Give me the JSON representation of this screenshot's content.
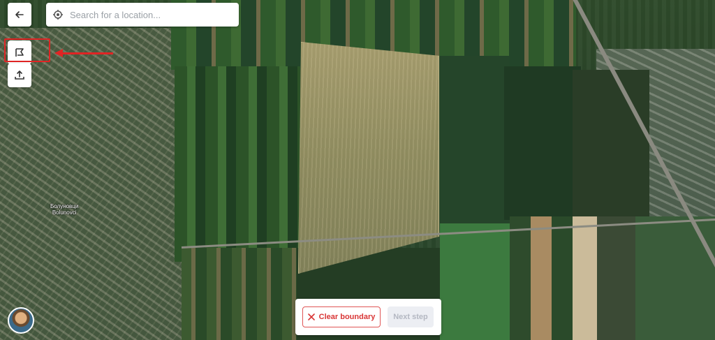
{
  "map": {
    "place_label_line1": "Болуновци",
    "place_label_line2": "Bolunovci"
  },
  "search": {
    "placeholder": "Search for a location..."
  },
  "toolbar": {
    "back_icon": "arrow-left-icon",
    "boundary_icon": "draw-boundary-icon",
    "upload_icon": "upload-icon"
  },
  "annotation": {
    "highlight_color": "#e02424"
  },
  "bottom_panel": {
    "clear_label": "Clear boundary",
    "next_label": "Next step"
  },
  "colors": {
    "danger": "#d93636",
    "disabled_bg": "#eceef3",
    "disabled_text": "#b4b8c2"
  }
}
